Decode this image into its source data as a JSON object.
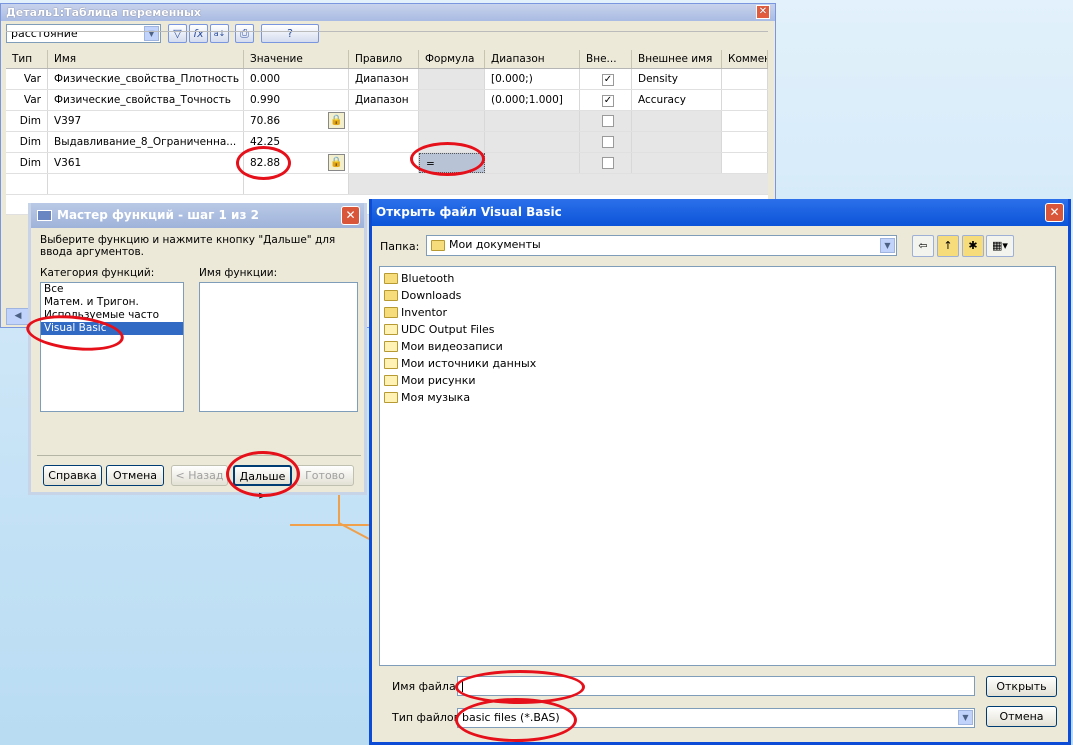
{
  "variable_table": {
    "title": "Деталь1:Таблица переменных",
    "filter_value": "расстояние",
    "help_button": "?",
    "columns": [
      "Тип",
      "Имя",
      "Значение",
      "Правило",
      "Формула",
      "Диапазон",
      "Вне...",
      "Внешнее имя",
      "Коммент"
    ],
    "rows": [
      {
        "type": "Var",
        "name": "Физические_свойства_Плотность",
        "value": "0.000",
        "rule": "Диапазон",
        "formula": "",
        "range": "[0.000;)",
        "external": true,
        "ext_name": "Density",
        "locked": false
      },
      {
        "type": "Var",
        "name": "Физические_свойства_Точность",
        "value": "0.990",
        "rule": "Диапазон",
        "formula": "",
        "range": "(0.000;1.000]",
        "external": true,
        "ext_name": "Accuracy",
        "locked": false
      },
      {
        "type": "Dim",
        "name": "V397",
        "value": "70.86",
        "rule": "",
        "formula": "",
        "range": "",
        "external": false,
        "ext_name": "",
        "locked": true
      },
      {
        "type": "Dim",
        "name": "Выдавливание_8_Ограниченна...",
        "value": "42.25",
        "rule": "",
        "formula": "",
        "range": "",
        "external": false,
        "ext_name": "",
        "locked": false
      },
      {
        "type": "Dim",
        "name": "V361",
        "value": "82.88",
        "rule": "",
        "formula": "=",
        "range": "",
        "external": false,
        "ext_name": "",
        "locked": true
      }
    ]
  },
  "function_wizard": {
    "title": "Мастер функций - шаг 1 из 2",
    "instruction": "Выберите функцию и нажмите кнопку \"Дальше\" для ввода аргументов.",
    "category_label": "Категория функций:",
    "name_label": "Имя функции:",
    "categories": [
      "Все",
      "Матем. и Тригон.",
      "Используемые часто",
      "Visual Basic"
    ],
    "selected_category": "Visual Basic",
    "buttons": {
      "help": "Справка",
      "cancel": "Отмена",
      "back": "< Назад",
      "next": "Дальше >",
      "finish": "Готово"
    }
  },
  "open_dialog": {
    "title": "Открыть файл Visual Basic",
    "folder_label": "Папка:",
    "folder_value": "Мои документы",
    "files": [
      "Bluetooth",
      "Downloads",
      "Inventor",
      "UDC Output Files",
      "Мои видеозаписи",
      "Мои источники данных",
      "Мои рисунки",
      "Моя музыка"
    ],
    "filename_label": "Имя файла:",
    "filename_value": "",
    "filetype_label": "Тип файлов:",
    "filetype_value": "basic files (*.BAS)",
    "open_button": "Открыть",
    "cancel_button": "Отмена"
  },
  "colors": {
    "selection": "#316ac5",
    "xp_title": "#0b54d8",
    "annotation": "#e5101a"
  }
}
